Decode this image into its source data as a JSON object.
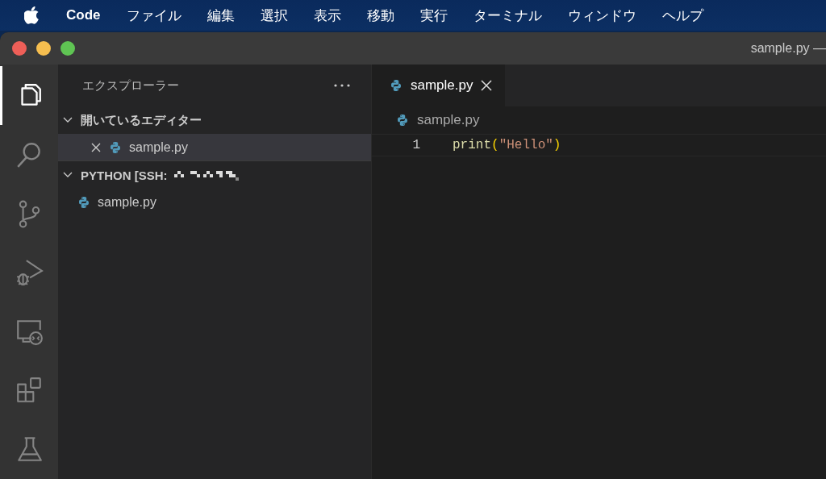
{
  "menu_bar": {
    "app": "Code",
    "items": [
      "ファイル",
      "編集",
      "選択",
      "表示",
      "移動",
      "実行",
      "ターミナル",
      "ウィンドウ",
      "ヘルプ"
    ]
  },
  "window": {
    "title": "sample.py —"
  },
  "activity_bar": [
    {
      "kind": "explorer",
      "selected": true
    },
    {
      "kind": "search",
      "selected": false
    },
    {
      "kind": "source-control",
      "selected": false
    },
    {
      "kind": "run-debug",
      "selected": false
    },
    {
      "kind": "remote",
      "selected": false
    },
    {
      "kind": "extensions",
      "selected": false
    },
    {
      "kind": "testing",
      "selected": false
    }
  ],
  "sidebar": {
    "title": "エクスプローラー",
    "sections": [
      {
        "title": "開いているエディター",
        "expanded": true,
        "redacted": false,
        "items": [
          {
            "name": "sample.py",
            "selected": true
          }
        ]
      },
      {
        "title": "PYTHON [SSH:",
        "expanded": true,
        "redacted": true,
        "items": [
          {
            "name": "sample.py",
            "selected": false
          }
        ]
      }
    ]
  },
  "tabs": [
    {
      "label": "sample.py",
      "selected": true
    }
  ],
  "breadcrumb": "sample.py",
  "code": [
    {
      "number": "1",
      "tokens": [
        {
          "kind": "function",
          "text": "print"
        },
        {
          "kind": "paren",
          "text": "("
        },
        {
          "kind": "string",
          "text": "\"Hello\""
        },
        {
          "kind": "paren",
          "text": ")"
        }
      ]
    }
  ]
}
